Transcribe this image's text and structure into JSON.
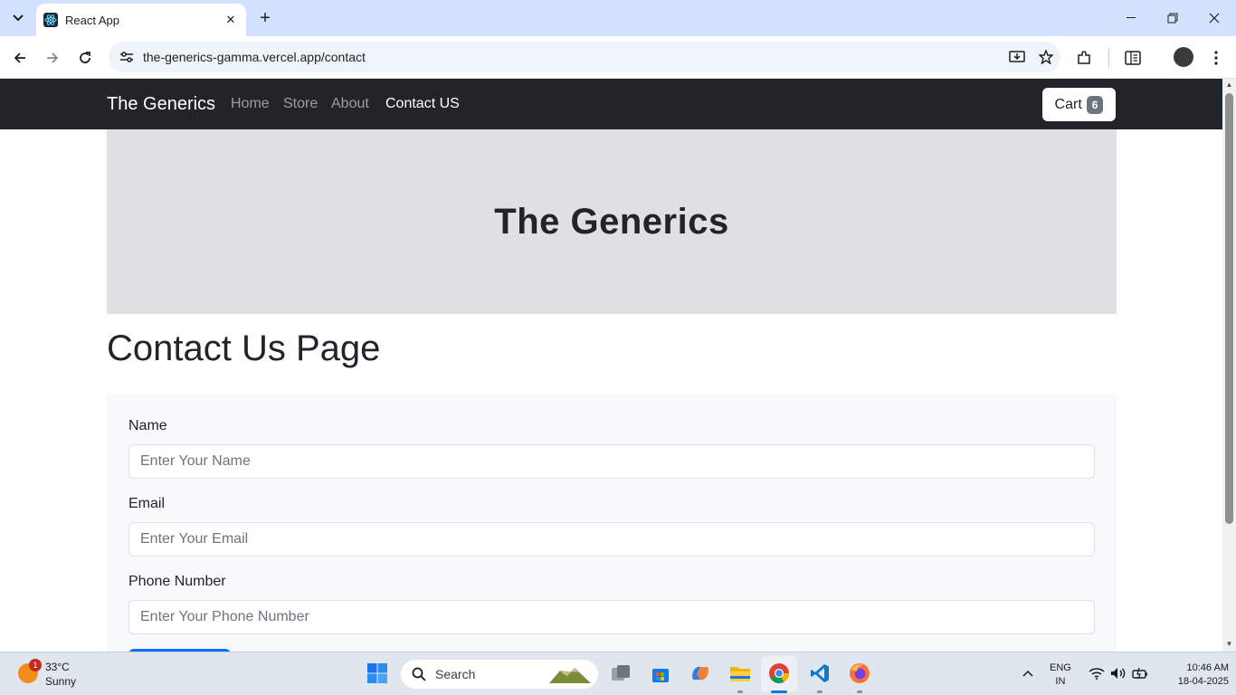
{
  "browser": {
    "tab_title": "React App",
    "url": "the-generics-gamma.vercel.app/contact"
  },
  "navbar": {
    "brand": "The Generics",
    "links": [
      "Home",
      "Store",
      "About",
      "Contact US"
    ],
    "active_link": "Contact US",
    "cart_label": "Cart",
    "cart_count": "6"
  },
  "hero": {
    "title": "The Generics"
  },
  "page": {
    "heading": "Contact Us Page"
  },
  "form": {
    "name_label": "Name",
    "name_placeholder": "Enter Your Name",
    "email_label": "Email",
    "email_placeholder": "Enter Your Email",
    "phone_label": "Phone Number",
    "phone_placeholder": "Enter Your Phone Number"
  },
  "taskbar": {
    "weather_badge": "1",
    "temperature": "33°C",
    "condition": "Sunny",
    "search_label": "Search",
    "lang_top": "ENG",
    "lang_bottom": "IN",
    "time": "10:46 AM",
    "date": "18-04-2025"
  },
  "colors": {
    "navbar_bg": "#212529",
    "hero_bg": "#e0e0e2",
    "form_bg": "#f8f9fa",
    "primary_button": "#0d6efd",
    "badge": "#6c757d",
    "chrome_tabstrip": "#d3e3fd"
  }
}
